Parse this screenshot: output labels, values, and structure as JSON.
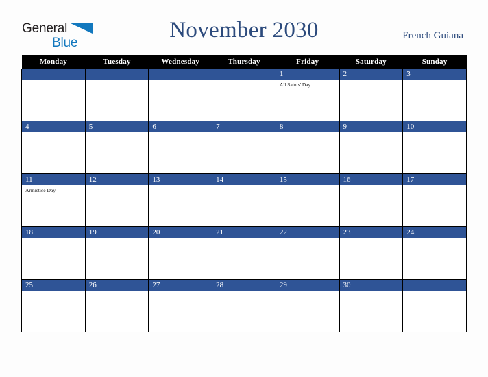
{
  "logo": {
    "word1": "General",
    "word2": "Blue",
    "triangle_color": "#1278be",
    "text_color": "#231f20"
  },
  "header": {
    "title": "November 2030",
    "country": "French Guiana",
    "title_color": "#2c4a7c"
  },
  "colors": {
    "header_row_bg": "#000000",
    "header_row_text": "#ffffff",
    "date_bar_bg": "#2f5496",
    "date_bar_text": "#ffffff",
    "cell_bg": "#ffffff",
    "grid_line": "#000000",
    "page_bg": "#fdfdfd"
  },
  "weekday_headers": [
    "Monday",
    "Tuesday",
    "Wednesday",
    "Thursday",
    "Friday",
    "Saturday",
    "Sunday"
  ],
  "weeks": [
    [
      {
        "day": "",
        "events": []
      },
      {
        "day": "",
        "events": []
      },
      {
        "day": "",
        "events": []
      },
      {
        "day": "",
        "events": []
      },
      {
        "day": "1",
        "events": [
          "All Saints' Day"
        ]
      },
      {
        "day": "2",
        "events": []
      },
      {
        "day": "3",
        "events": []
      }
    ],
    [
      {
        "day": "4",
        "events": []
      },
      {
        "day": "5",
        "events": []
      },
      {
        "day": "6",
        "events": []
      },
      {
        "day": "7",
        "events": []
      },
      {
        "day": "8",
        "events": []
      },
      {
        "day": "9",
        "events": []
      },
      {
        "day": "10",
        "events": []
      }
    ],
    [
      {
        "day": "11",
        "events": [
          "Armistice Day"
        ]
      },
      {
        "day": "12",
        "events": []
      },
      {
        "day": "13",
        "events": []
      },
      {
        "day": "14",
        "events": []
      },
      {
        "day": "15",
        "events": []
      },
      {
        "day": "16",
        "events": []
      },
      {
        "day": "17",
        "events": []
      }
    ],
    [
      {
        "day": "18",
        "events": []
      },
      {
        "day": "19",
        "events": []
      },
      {
        "day": "20",
        "events": []
      },
      {
        "day": "21",
        "events": []
      },
      {
        "day": "22",
        "events": []
      },
      {
        "day": "23",
        "events": []
      },
      {
        "day": "24",
        "events": []
      }
    ],
    [
      {
        "day": "25",
        "events": []
      },
      {
        "day": "26",
        "events": []
      },
      {
        "day": "27",
        "events": []
      },
      {
        "day": "28",
        "events": []
      },
      {
        "day": "29",
        "events": []
      },
      {
        "day": "30",
        "events": []
      },
      {
        "day": "",
        "events": []
      }
    ]
  ]
}
